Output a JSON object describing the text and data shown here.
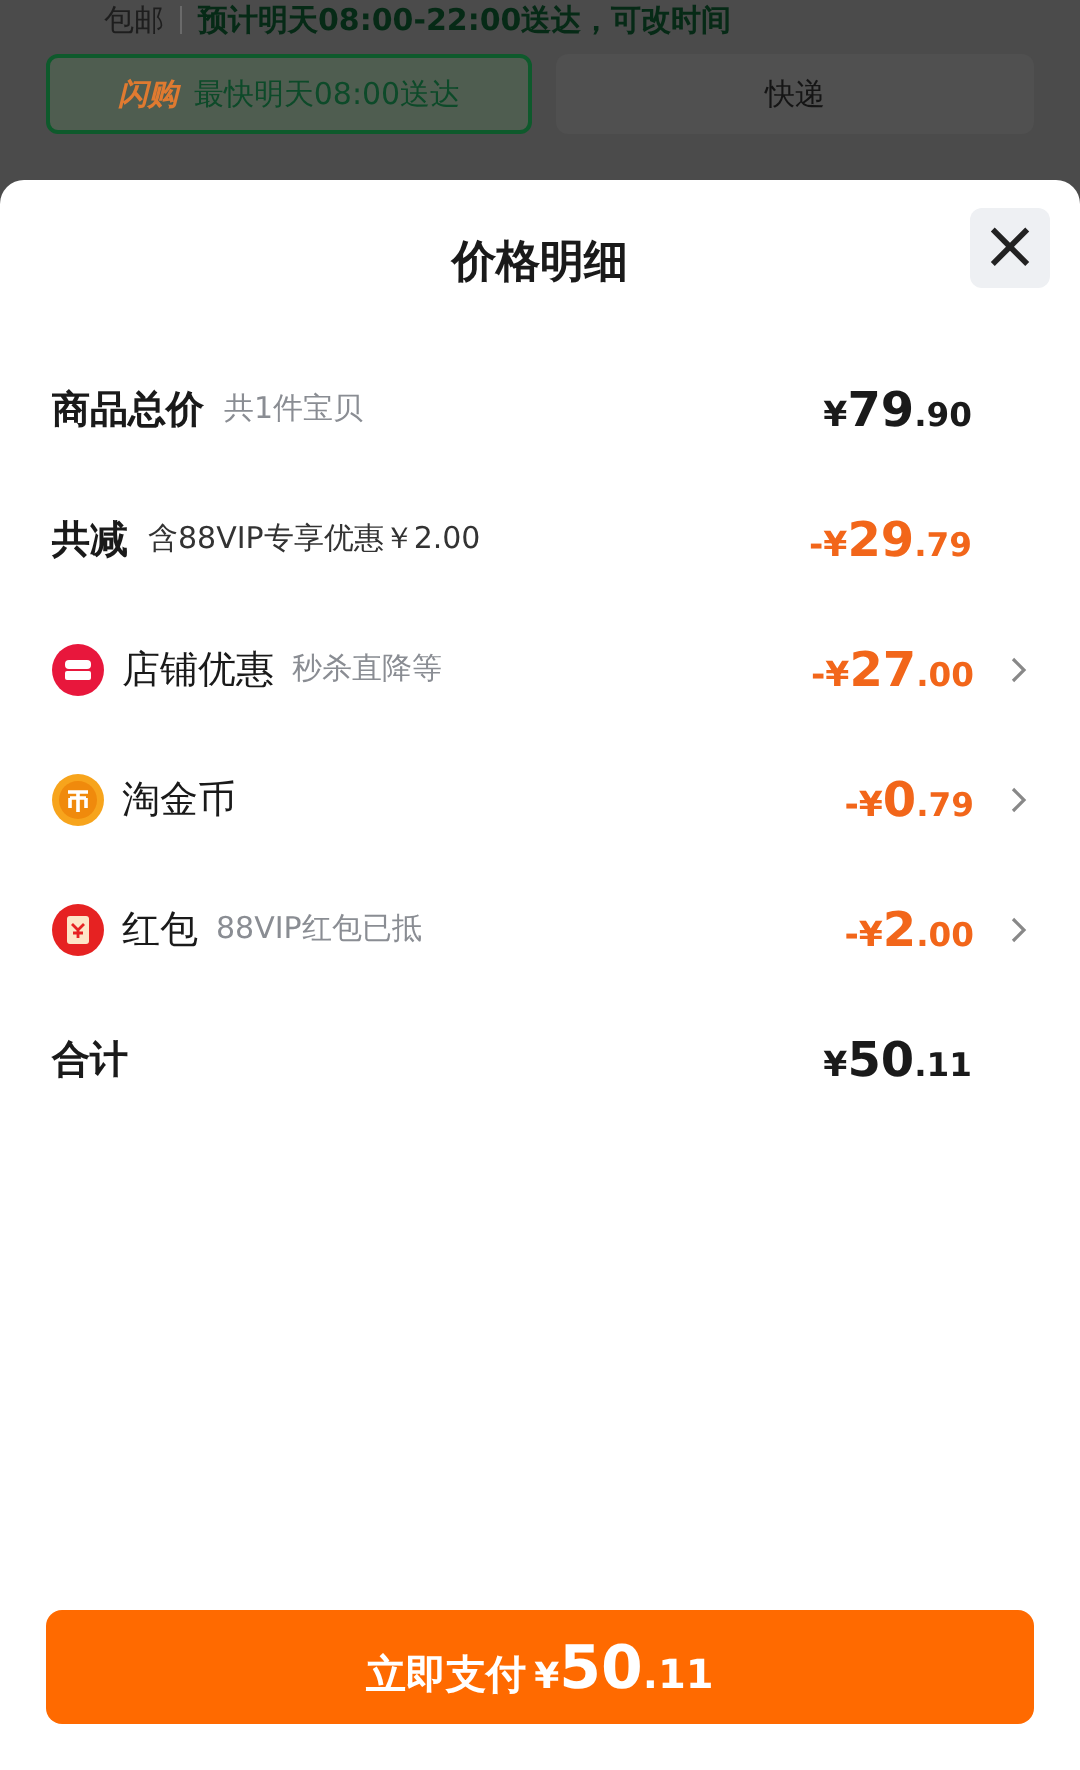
{
  "background": {
    "shipping_label": "包邮",
    "delivery_note": "预计明天08:00-22:00送达，可改时间",
    "delivery_options": [
      {
        "logo": "闪购",
        "label": "最快明天08:00送达",
        "selected": true
      },
      {
        "label": "快递",
        "selected": false
      }
    ]
  },
  "sheet": {
    "title": "价格明细",
    "close": "×",
    "rows": [
      {
        "kind": "summary",
        "label": "商品总价",
        "note": "共1件宝贝",
        "amount": {
          "prefix": "¥",
          "whole": "79",
          "fraction": ".90",
          "negative": false
        }
      },
      {
        "kind": "summary",
        "label": "共减",
        "note": "含88VIP专享优惠￥2.00",
        "amount": {
          "prefix": "-¥",
          "whole": "29",
          "fraction": ".79",
          "negative": true
        }
      },
      {
        "kind": "shop",
        "label": "店铺优惠",
        "note": "秒杀直降等",
        "amount": {
          "prefix": "-¥",
          "whole": "27",
          "fraction": ".00",
          "negative": true
        }
      },
      {
        "kind": "coin",
        "label": "淘金币",
        "amount": {
          "prefix": "-¥",
          "whole": "0",
          "fraction": ".79",
          "negative": true
        }
      },
      {
        "kind": "red-packet",
        "label": "红包",
        "note": "88VIP红包已抵",
        "amount": {
          "prefix": "-¥",
          "whole": "2",
          "fraction": ".00",
          "negative": true
        }
      },
      {
        "kind": "summary",
        "label": "合计",
        "amount": {
          "prefix": "¥",
          "whole": "50",
          "fraction": ".11",
          "negative": false
        }
      }
    ],
    "pay_button": {
      "label": "立即支付",
      "amount": {
        "prefix": "¥",
        "whole": "50",
        "fraction": ".11"
      }
    }
  }
}
